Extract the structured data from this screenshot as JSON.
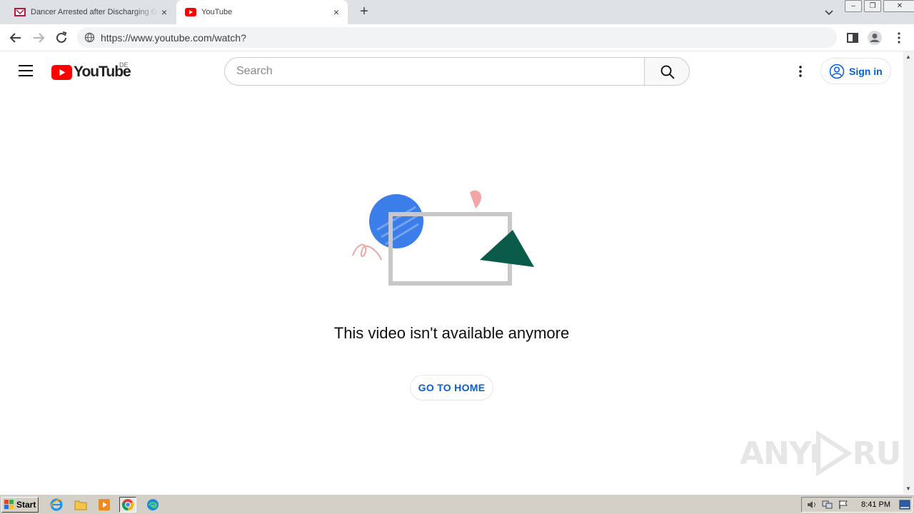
{
  "browser": {
    "tabs": [
      {
        "title": "Dancer Arrested after Discharging G",
        "active": false,
        "favicon": "news-favicon-icon"
      },
      {
        "title": "YouTube",
        "active": true,
        "favicon": "youtube-favicon-icon"
      }
    ],
    "new_tab": "+",
    "close_glyph": "×",
    "url": "https://www.youtube.com/watch?"
  },
  "youtube": {
    "logo_text": "YouTube",
    "country_code": "DE",
    "search_placeholder": "Search",
    "signin_label": "Sign in",
    "message": "This video isn't available anymore",
    "home_button": "GO TO HOME",
    "colors": {
      "brand_red": "#ff0000",
      "link_blue": "#065fd4"
    }
  },
  "watermark": {
    "text_left": "ANY",
    "text_right": "RUN"
  },
  "taskbar": {
    "start_label": "Start",
    "apps": [
      "internet-explorer-icon",
      "file-explorer-icon",
      "media-player-icon",
      "chrome-icon",
      "edge-icon"
    ],
    "clock": "8:41 PM"
  }
}
